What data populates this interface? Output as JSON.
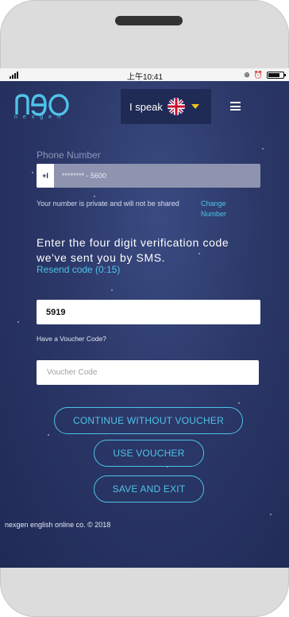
{
  "status_bar": {
    "time": "上午10:41",
    "icons": [
      "signal-icon",
      "alarm-icon",
      "orientation-lock-icon",
      "battery-icon"
    ]
  },
  "brand": {
    "logo_text": "neo",
    "logo_sub": "nexgen",
    "accent_color": "#4fc3e8"
  },
  "header": {
    "language_label": "I speak",
    "language_flag": "uk-flag-icon",
    "menu_icon": "hamburger-menu-icon"
  },
  "form": {
    "phone_label": "Phone Number",
    "phone_prefix": "+I",
    "phone_value": "******** - 5600",
    "private_note": "Your number is private and will not be shared",
    "change_number": "Change Number",
    "verify_text": "Enter the four digit verification code we've sent you by SMS.",
    "resend_code": "Resend code (0:15)",
    "code_value": "5919",
    "voucher_question": "Have a Voucher Code?",
    "voucher_placeholder": "Voucher Code"
  },
  "buttons": {
    "continue_without_voucher": "CONTINUE WITHOUT VOUCHER",
    "use_voucher": "USE VOUCHER",
    "save_and_exit": "SAVE AND EXIT"
  },
  "footer": {
    "copyright": "nexgen english online co. © 2018"
  },
  "colors": {
    "background": "#2b3767",
    "accent": "#4fc3e8",
    "caret": "#f0c419"
  }
}
